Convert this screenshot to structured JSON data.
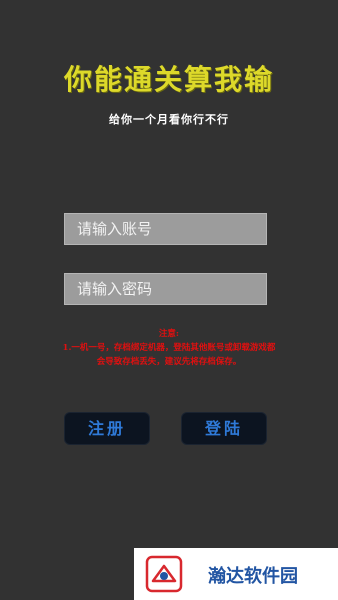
{
  "header": {
    "title": "你能通关算我输",
    "subtitle": "给你一个月看你行不行"
  },
  "form": {
    "account_placeholder": "请输入账号",
    "password_placeholder": "请输入密码"
  },
  "notice": {
    "title": "注意:",
    "body": "1.一机一号，存档绑定机器，登陆其他账号或卸载游戏都会导致存档丢失，建议先将存档保存。"
  },
  "buttons": {
    "register_label": "注册",
    "login_label": "登陆"
  },
  "watermark": {
    "text": "瀚达软件园"
  },
  "colors": {
    "background": "#323232",
    "title": "#ddd92a",
    "notice": "#e01010",
    "button_text": "#2f7ad8",
    "button_bg": "#0c1420",
    "watermark_text": "#2255a3",
    "watermark_logo": "#d8282e"
  }
}
